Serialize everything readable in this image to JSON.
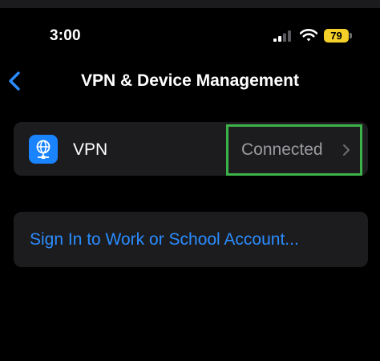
{
  "status_bar": {
    "time": "3:00",
    "battery_level": "79",
    "icons": [
      "cellular-signal-icon",
      "wifi-icon",
      "battery-icon"
    ]
  },
  "nav": {
    "back_icon": "chevron-left-icon",
    "title": "VPN & Device Management"
  },
  "vpn_row": {
    "icon": "globe-network-icon",
    "label": "VPN",
    "status": "Connected",
    "chevron_icon": "chevron-right-icon",
    "highlight_color": "#3bb34a"
  },
  "signin_row": {
    "label": "Sign In to Work or School Account..."
  },
  "colors": {
    "background": "#000000",
    "card": "#1c1c1e",
    "accent": "#2a8cff",
    "secondary_text": "#9b9ba0",
    "battery": "#f4d028"
  }
}
